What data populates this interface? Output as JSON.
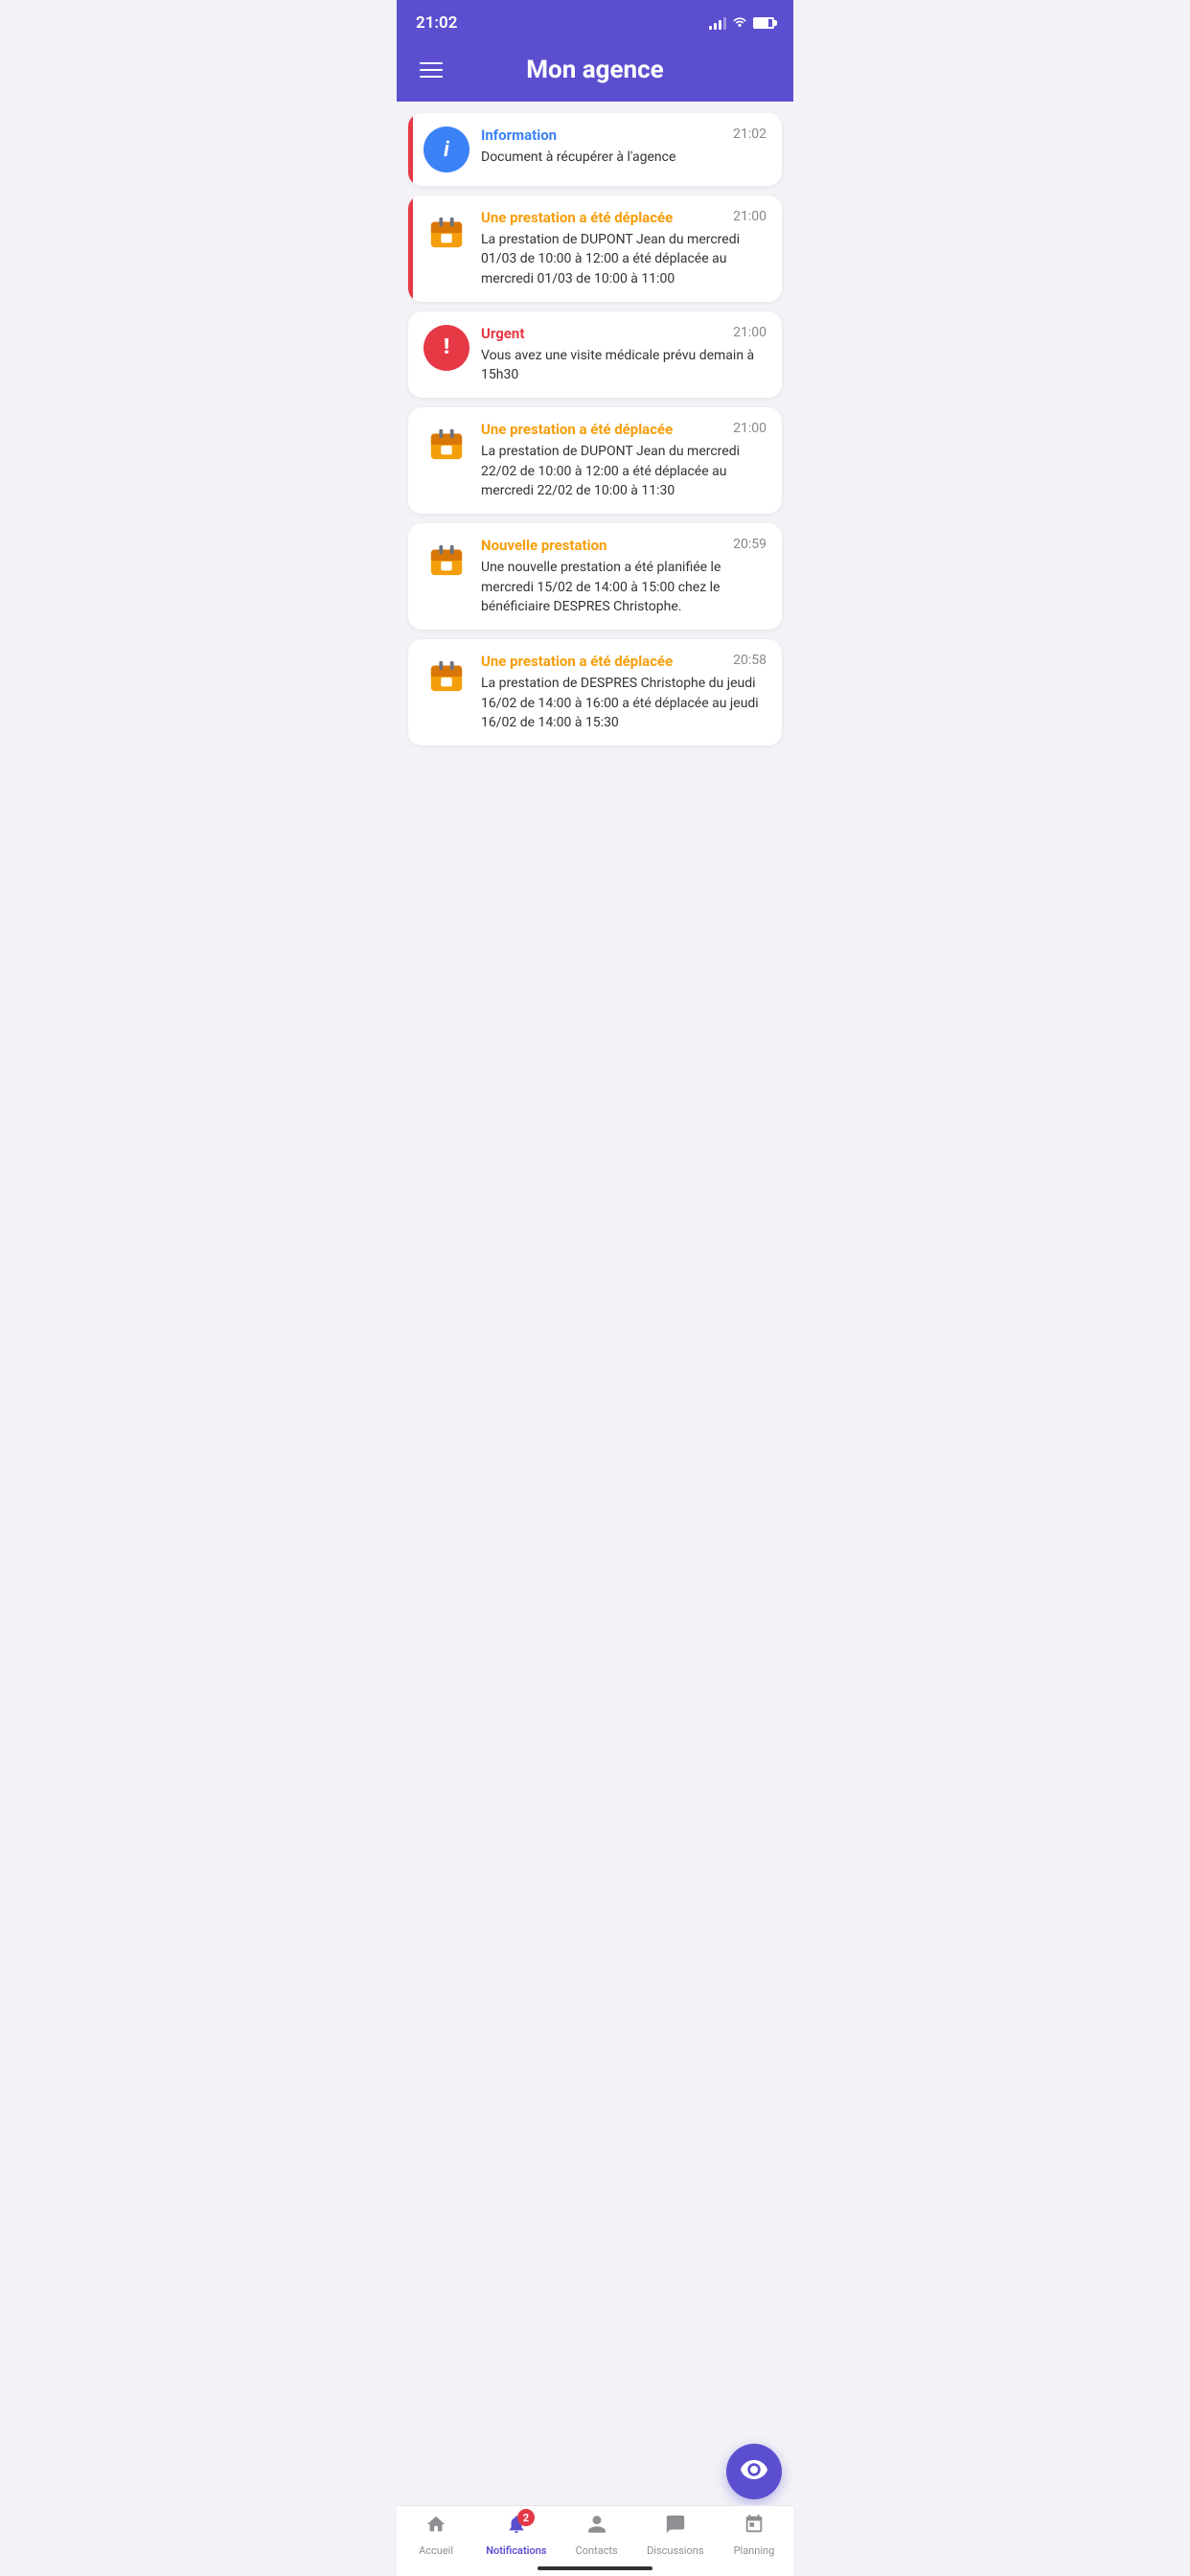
{
  "statusBar": {
    "time": "21:02"
  },
  "header": {
    "title": "Mon agence",
    "menuIcon": "hamburger-icon"
  },
  "notifications": [
    {
      "id": 1,
      "type": "information",
      "iconType": "info",
      "iconColor": "blue",
      "title": "Information",
      "titleColor": "blue",
      "time": "21:02",
      "body": "Document à récupérer à l'agence",
      "hasLeftBar": true
    },
    {
      "id": 2,
      "type": "prestation-deplacee",
      "iconType": "calendar",
      "iconColor": "orange",
      "title": "Une prestation a été déplacée",
      "titleColor": "orange",
      "time": "21:00",
      "body": "La prestation de DUPONT Jean du mercredi 01/03 de 10:00 à 12:00 a été déplacée au mercredi 01/03 de 10:00 à 11:00",
      "hasLeftBar": true
    },
    {
      "id": 3,
      "type": "urgent",
      "iconType": "urgent",
      "iconColor": "red",
      "title": "Urgent",
      "titleColor": "red",
      "time": "21:00",
      "body": "Vous avez une visite médicale prévu demain à 15h30",
      "hasLeftBar": false
    },
    {
      "id": 4,
      "type": "prestation-deplacee",
      "iconType": "calendar",
      "iconColor": "orange",
      "title": "Une prestation a été déplacée",
      "titleColor": "orange",
      "time": "21:00",
      "body": "La prestation de DUPONT Jean du mercredi 22/02 de 10:00 à 12:00 a été déplacée au mercredi 22/02 de 10:00 à 11:30",
      "hasLeftBar": false
    },
    {
      "id": 5,
      "type": "nouvelle-prestation",
      "iconType": "calendar",
      "iconColor": "orange",
      "title": "Nouvelle prestation",
      "titleColor": "orange",
      "time": "20:59",
      "body": "Une nouvelle prestation a été planifiée le mercredi 15/02 de 14:00 à 15:00 chez le bénéficiaire DESPRES Christophe.",
      "hasLeftBar": false
    },
    {
      "id": 6,
      "type": "prestation-deplacee",
      "iconType": "calendar",
      "iconColor": "orange",
      "title": "Une prestation a été déplacée",
      "titleColor": "orange",
      "time": "20:58",
      "body": "La prestation de DESPRES Christophe du jeudi 16/02 de 14:00 à 16:00 a été déplacée au jeudi 16/02 de 14:00 à 15:30",
      "hasLeftBar": false
    }
  ],
  "fab": {
    "icon": "eye-icon"
  },
  "tabBar": {
    "tabs": [
      {
        "id": "accueil",
        "label": "Accueil",
        "icon": "home-icon",
        "active": false
      },
      {
        "id": "notifications",
        "label": "Notifications",
        "icon": "bell-icon",
        "active": true,
        "badge": "2"
      },
      {
        "id": "contacts",
        "label": "Contacts",
        "icon": "contact-icon",
        "active": false
      },
      {
        "id": "discussions",
        "label": "Discussions",
        "icon": "chat-icon",
        "active": false
      },
      {
        "id": "planning",
        "label": "Planning",
        "icon": "calendar-tab-icon",
        "active": false
      }
    ]
  }
}
